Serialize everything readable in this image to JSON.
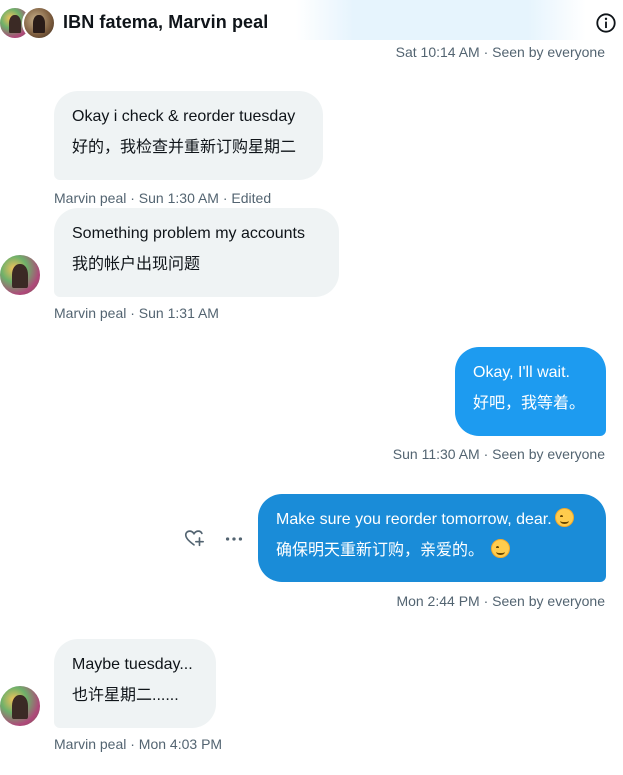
{
  "header": {
    "title": "IBN fatema, Marvin peal",
    "avatar_icon": "group-avatar",
    "info_icon": "info-icon"
  },
  "messages": [
    {
      "id": "m0",
      "meta": "Sat 10:14 AM · Seen by everyone"
    },
    {
      "id": "m1",
      "direction": "incoming",
      "lines": [
        "Okay i check & reorder tuesday",
        "好的，我检查并重新订购星期二"
      ],
      "meta": "Marvin peal · Sun 1:30 AM · Edited"
    },
    {
      "id": "m2",
      "direction": "incoming",
      "lines": [
        "Something problem my accounts",
        "我的帐户出现问题"
      ],
      "meta": "Marvin peal · Sun 1:31 AM"
    },
    {
      "id": "m3",
      "direction": "outgoing",
      "lines": [
        "Okay, I'll wait.",
        "好吧，我等着。"
      ],
      "meta": "Sun 11:30 AM · Seen by everyone"
    },
    {
      "id": "m4",
      "direction": "outgoing",
      "lines": [
        "Make sure you reorder tomorrow, dear.",
        "确保明天重新订购，亲爱的。"
      ],
      "emoji": "smiling-face-emoji",
      "meta": "Mon 2:44 PM · Seen by everyone"
    },
    {
      "id": "m5",
      "direction": "incoming",
      "lines": [
        "Maybe tuesday...",
        "也许星期二......"
      ],
      "meta": "Marvin peal · Mon 4:03 PM"
    }
  ],
  "actions": {
    "react_icon": "heart-plus-icon",
    "more_icon": "more-icon"
  },
  "colors": {
    "outgoing_bubble": "#1d9bf0",
    "outgoing_bubble_hover": "#1a8cd8",
    "incoming_bubble": "#eff3f4",
    "meta_text": "#536471"
  }
}
